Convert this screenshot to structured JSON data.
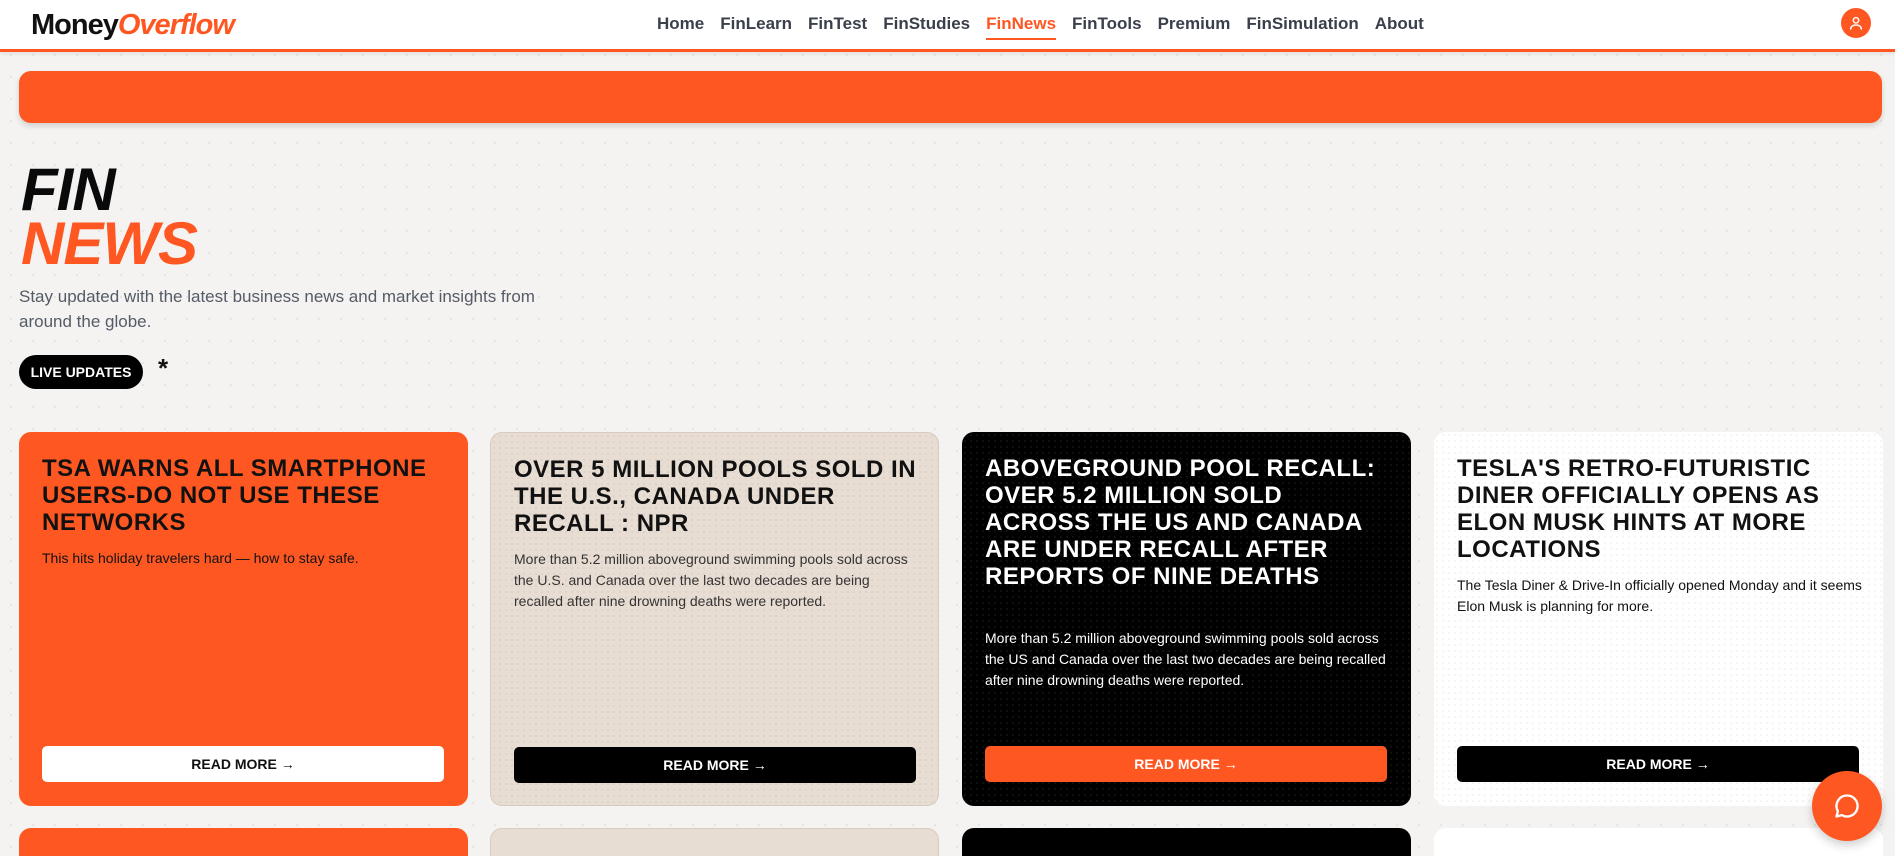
{
  "header": {
    "logo_part1": "Money",
    "logo_part2": "Overflow",
    "nav": [
      "Home",
      "FinLearn",
      "FinTest",
      "FinStudies",
      "FinNews",
      "FinTools",
      "Premium",
      "FinSimulation",
      "About"
    ],
    "active_nav": "FinNews",
    "user_icon": "user-icon"
  },
  "hero": {
    "title_line1": "FIN",
    "title_line2": "NEWS",
    "subtitle": "Stay updated with the latest business news and market insights from around the globe.",
    "live_badge": "LIVE UPDATES",
    "asterisk": "*"
  },
  "cards": [
    {
      "style": "orange",
      "title": "TSA WARNS ALL SMARTPHONE USERS-DO NOT USE THESE NETWORKS",
      "description": "This hits holiday travelers hard — how to stay safe.",
      "button": "READ MORE →"
    },
    {
      "style": "beige",
      "title": "OVER 5 MILLION POOLS SOLD IN THE U.S., CANADA UNDER RECALL : NPR",
      "description": "More than 5.2 million aboveground swimming pools sold across the U.S. and Canada over the last two decades are being recalled after nine drowning deaths were reported.",
      "button": "READ MORE →"
    },
    {
      "style": "black",
      "title": "ABOVEGROUND POOL RECALL: OVER 5.2 MILLION SOLD ACROSS THE US AND CANADA ARE UNDER RECALL AFTER REPORTS OF NINE DEATHS",
      "description": "More than 5.2 million aboveground swimming pools sold across the US and Canada over the last two decades are being recalled after nine drowning deaths were reported.",
      "button": "READ MORE →"
    },
    {
      "style": "white",
      "title": "TESLA'S RETRO-FUTURISTIC DINER OFFICIALLY OPENS AS ELON MUSK HINTS AT MORE LOCATIONS",
      "description": "The Tesla Diner & Drive-In officially opened Monday and it seems Elon Musk is planning for more.",
      "button": "READ MORE →"
    }
  ],
  "chat_icon": "chat-bubble-icon",
  "colors": {
    "accent": "#ff5722",
    "beige": "#e8ddd3",
    "black": "#000000",
    "white": "#ffffff"
  }
}
